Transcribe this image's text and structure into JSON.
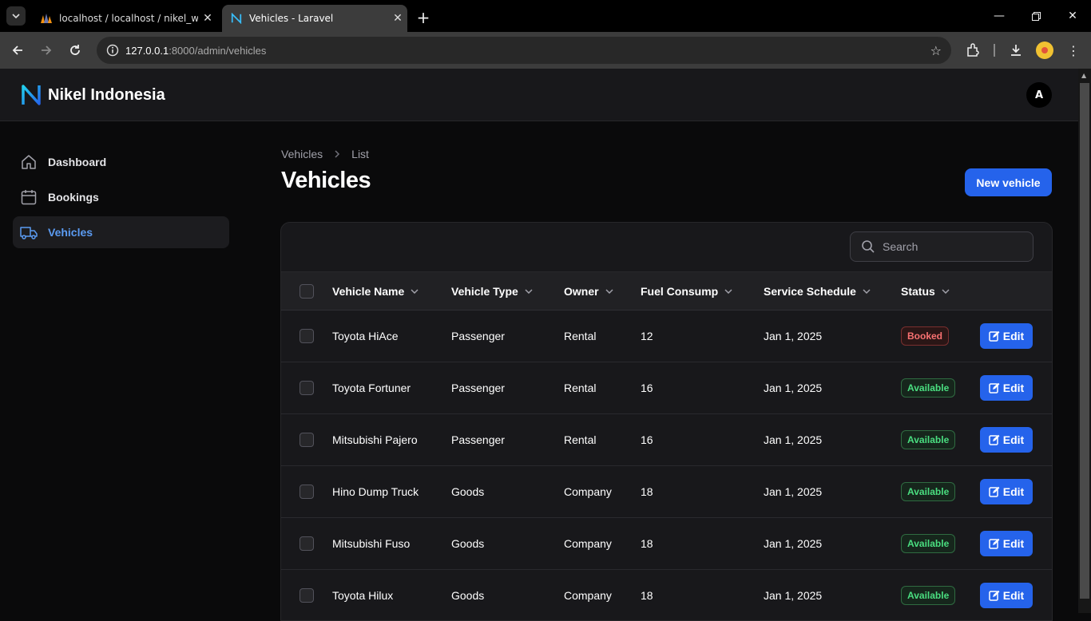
{
  "browser": {
    "tabs": [
      {
        "title": "localhost / localhost / nikel_we",
        "active": false
      },
      {
        "title": "Vehicles - Laravel",
        "active": true
      }
    ],
    "url_host": "127.0.0.1",
    "url_rest": ":8000/admin/vehicles"
  },
  "header": {
    "brand": "Nikel Indonesia",
    "avatar_initial": "A"
  },
  "sidebar": {
    "items": [
      {
        "label": "Dashboard",
        "icon": "home-icon",
        "active": false
      },
      {
        "label": "Bookings",
        "icon": "calendar-icon",
        "active": false
      },
      {
        "label": "Vehicles",
        "icon": "truck-icon",
        "active": true
      }
    ]
  },
  "page": {
    "breadcrumb": [
      "Vehicles",
      "List"
    ],
    "title": "Vehicles",
    "new_button": "New vehicle"
  },
  "table": {
    "search_placeholder": "Search",
    "columns": [
      "Vehicle Name",
      "Vehicle Type",
      "Owner",
      "Fuel Consump",
      "Service Schedule",
      "Status"
    ],
    "edit_label": "Edit",
    "rows": [
      {
        "name": "Toyota HiAce",
        "type": "Passenger",
        "owner": "Rental",
        "fuel": "12",
        "schedule": "Jan 1, 2025",
        "status": "Booked"
      },
      {
        "name": "Toyota Fortuner",
        "type": "Passenger",
        "owner": "Rental",
        "fuel": "16",
        "schedule": "Jan 1, 2025",
        "status": "Available"
      },
      {
        "name": "Mitsubishi Pajero",
        "type": "Passenger",
        "owner": "Rental",
        "fuel": "16",
        "schedule": "Jan 1, 2025",
        "status": "Available"
      },
      {
        "name": "Hino Dump Truck",
        "type": "Goods",
        "owner": "Company",
        "fuel": "18",
        "schedule": "Jan 1, 2025",
        "status": "Available"
      },
      {
        "name": "Mitsubishi Fuso",
        "type": "Goods",
        "owner": "Company",
        "fuel": "18",
        "schedule": "Jan 1, 2025",
        "status": "Available"
      },
      {
        "name": "Toyota Hilux",
        "type": "Goods",
        "owner": "Company",
        "fuel": "18",
        "schedule": "Jan 1, 2025",
        "status": "Available"
      }
    ]
  },
  "colors": {
    "accent": "#2563eb",
    "active_nav": "#5b9bf2",
    "available": "#4ade80",
    "booked": "#f87171"
  }
}
